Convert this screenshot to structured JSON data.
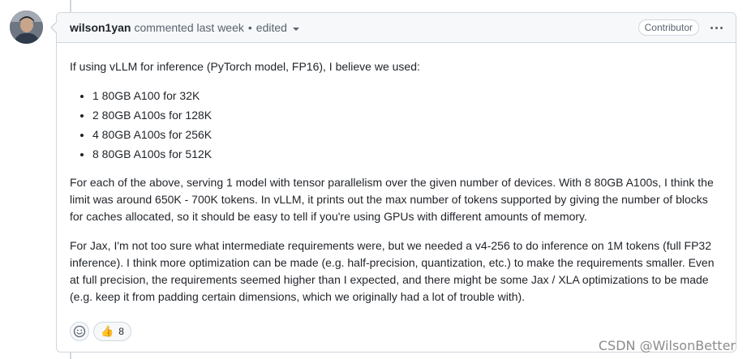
{
  "comment": {
    "author": "wilson1yan",
    "action": "commented",
    "time": "last week",
    "separator": "•",
    "edited_label": "edited",
    "role_badge": "Contributor",
    "intro": "If using vLLM for inference (PyTorch model, FP16), I believe we used:",
    "list": [
      "1 80GB A100 for 32K",
      "2 80GB A100s for 128K",
      "4 80GB A100s for 256K",
      "8 80GB A100s for 512K"
    ],
    "para2": "For each of the above, serving 1 model with tensor parallelism over the given number of devices. With 8 80GB A100s, I think the limit was around 650K - 700K tokens. In vLLM, it prints out the max number of tokens supported by giving the number of blocks for caches allocated, so it should be easy to tell if you're using GPUs with different amounts of memory.",
    "para3": "For Jax, I'm not too sure what intermediate requirements were, but we needed a v4-256 to do inference on 1M tokens (full FP32 inference). I think more optimization can be made (e.g. half-precision, quantization, etc.) to make the requirements smaller. Even at full precision, the requirements seemed higher than I expected, and there might be some Jax / XLA optimizations to be made (e.g. keep it from padding certain dimensions, which we originally had a lot of trouble with)."
  },
  "reactions": {
    "thumbs_up_emoji": "👍",
    "thumbs_up_count": "8"
  },
  "watermark": "CSDN @WilsonBetter",
  "colors": {
    "border": "#d0d7de",
    "header_bg": "#f6f8fa",
    "text": "#1f2328",
    "muted": "#59636e"
  }
}
